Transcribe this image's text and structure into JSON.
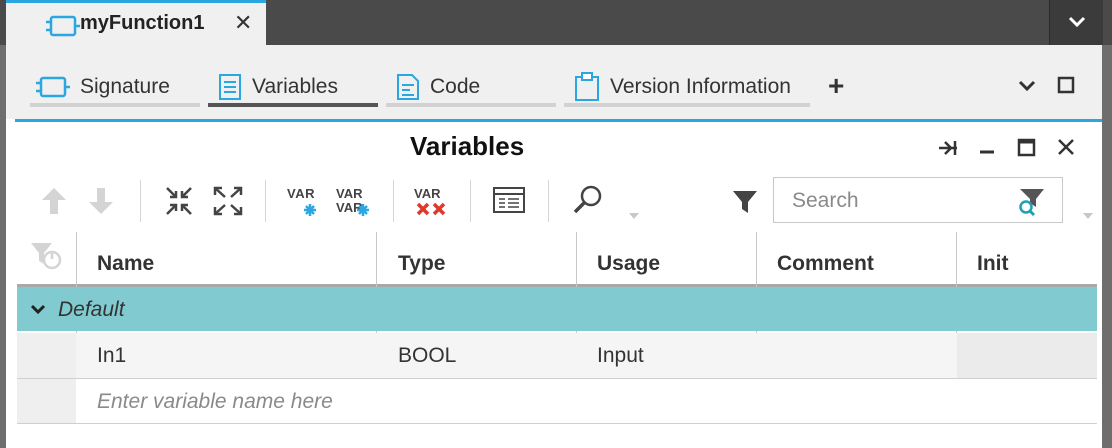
{
  "document_tab": {
    "title": "myFunction1",
    "close_glyph": "✕"
  },
  "doc_menu_glyph": "⌄",
  "subtabs": [
    {
      "label": "Signature",
      "icon": "signature-icon",
      "active": false
    },
    {
      "label": "Variables",
      "icon": "variables-icon",
      "active": true
    },
    {
      "label": "Code",
      "icon": "code-icon",
      "active": false
    },
    {
      "label": "Version Information",
      "icon": "clipboard-icon",
      "active": false
    }
  ],
  "add_tab_glyph": "+",
  "panel": {
    "title": "Variables"
  },
  "toolbar": {
    "var_label": "VAR",
    "search": {
      "placeholder": "Search",
      "value": ""
    }
  },
  "grid": {
    "columns": [
      "Name",
      "Type",
      "Usage",
      "Comment",
      "Init"
    ],
    "group": "Default",
    "rows": [
      {
        "name": "In1",
        "type": "BOOL",
        "usage": "Input",
        "comment": "",
        "init": ""
      }
    ],
    "new_row_placeholder": "Enter variable name here"
  },
  "colors": {
    "accent": "#2aa7e0",
    "group_row": "#81cbd0",
    "delete": "#e0392b",
    "var_add": "#2aa7e0"
  }
}
